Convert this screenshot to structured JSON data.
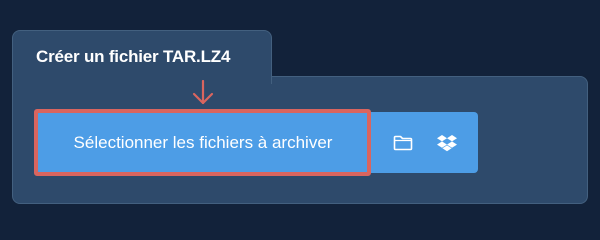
{
  "panel": {
    "title": "Créer un fichier TAR.LZ4"
  },
  "buttons": {
    "select_files_label": "Sélectionner les fichiers à archiver",
    "folder_icon": "folder-icon",
    "dropbox_icon": "dropbox-icon"
  },
  "annotation": {
    "highlight_color": "#d9655f",
    "arrow_icon": "arrow-down-icon"
  },
  "colors": {
    "background": "#12223a",
    "panel": "#2e4a6b",
    "button": "#4d9de6",
    "text": "#ffffff"
  }
}
